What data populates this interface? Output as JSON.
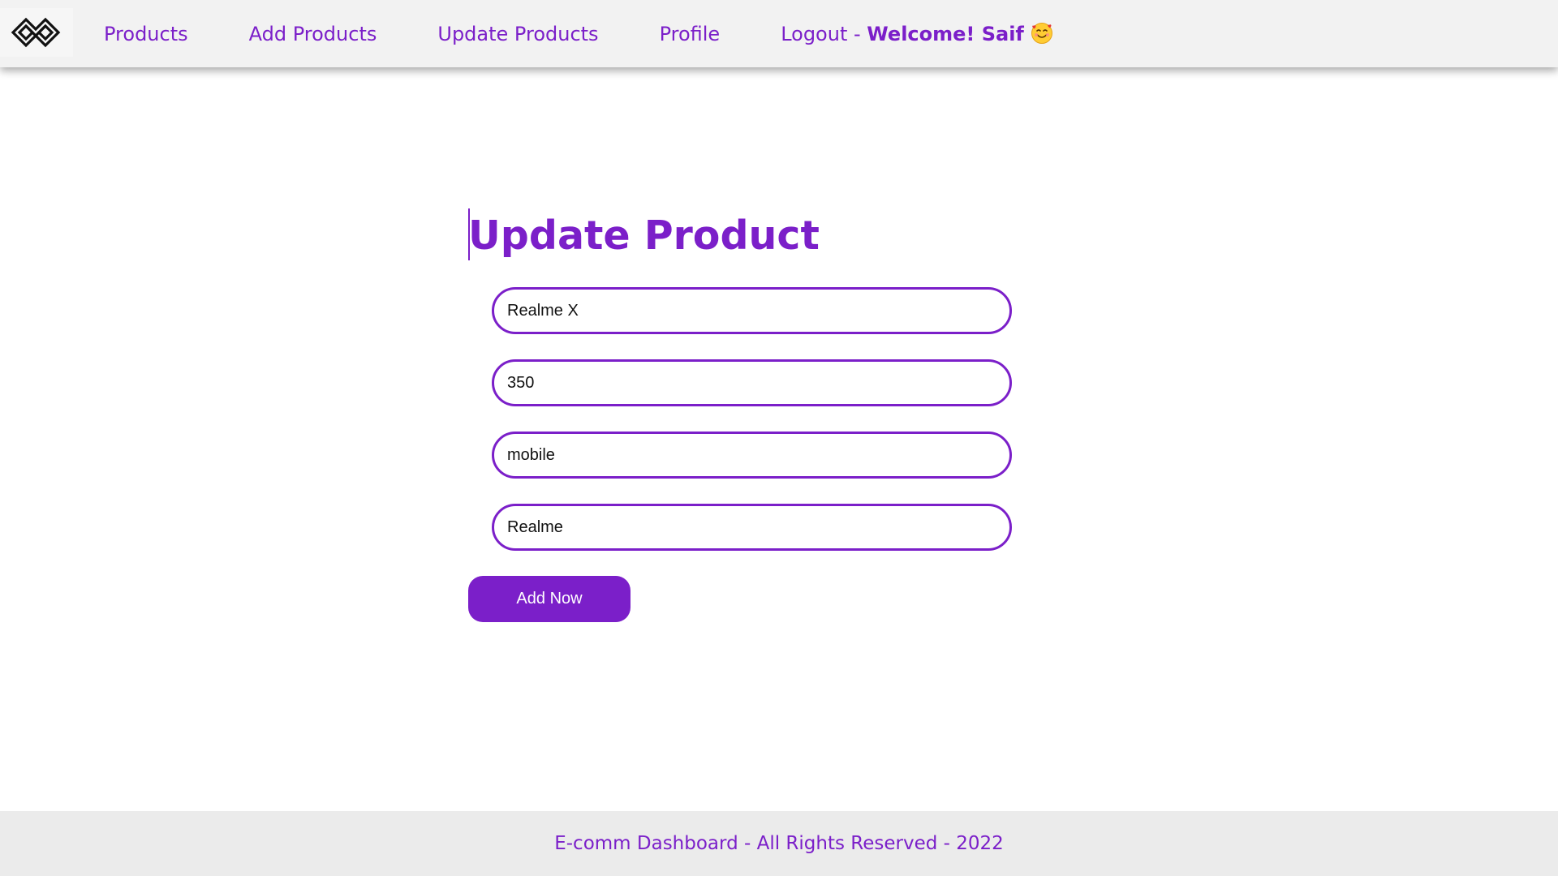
{
  "colors": {
    "accent": "#7b1fc9",
    "navbar_bg": "#f2f2f2",
    "footer_bg": "#ebebeb"
  },
  "navbar": {
    "logo_icon": "interlocking-diamonds-logo-icon",
    "links": {
      "products": "Products",
      "add_products": "Add Products",
      "update_products": "Update Products",
      "profile": "Profile",
      "logout": "Logout -"
    },
    "welcome": "Welcome! Saif",
    "welcome_icon": "smiling-face-with-hearts-emoji-icon"
  },
  "main": {
    "title": "Update Product",
    "fields": {
      "name": "Realme X",
      "price": "350",
      "category": "mobile",
      "company": "Realme"
    },
    "submit_label": "Add Now"
  },
  "footer": {
    "text": "E-comm Dashboard - All Rights Reserved - 2022"
  }
}
